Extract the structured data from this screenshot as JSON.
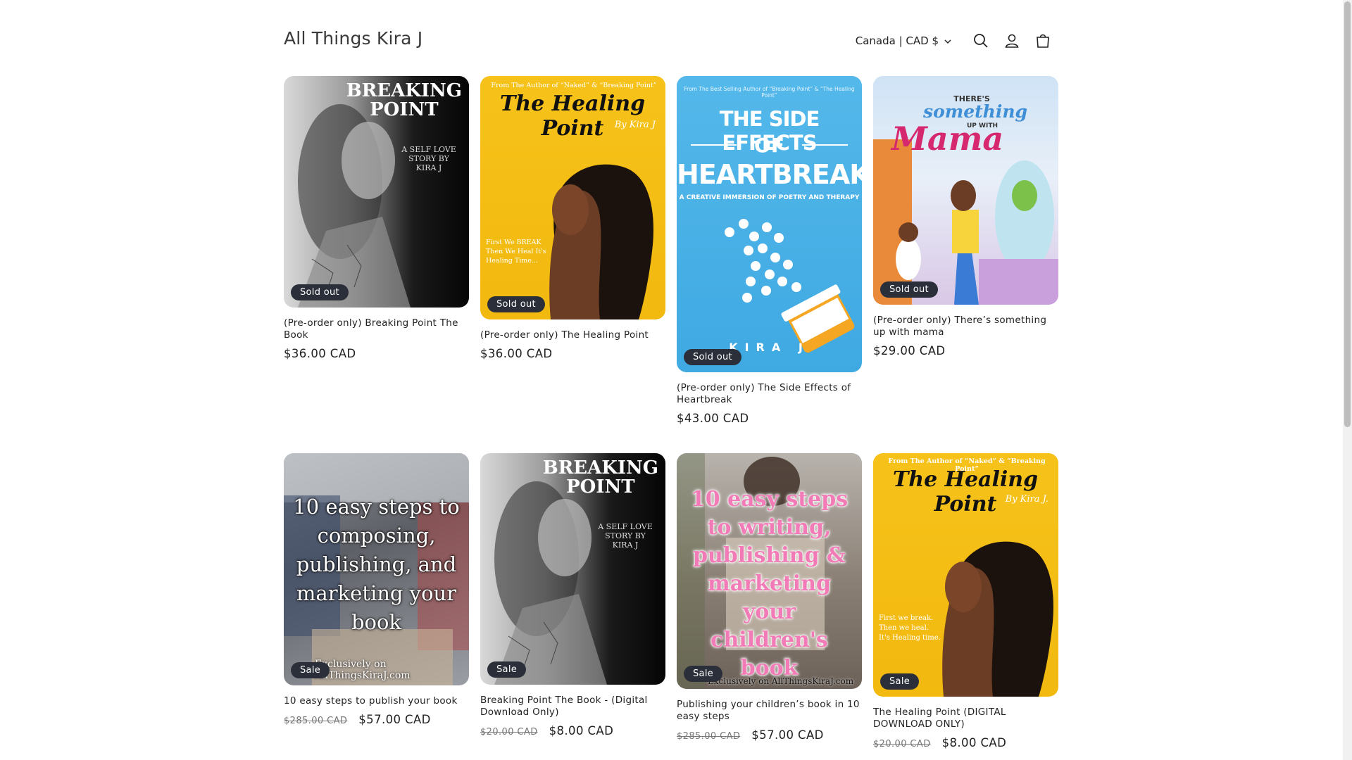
{
  "header": {
    "logo": "All Things Kira J",
    "country_selector": "Canada | CAD $",
    "icons": [
      "search-icon",
      "account-icon",
      "cart-icon"
    ]
  },
  "colors": {
    "badge_bg": "#2b2f3a",
    "text": "#222222",
    "muted": "#777777",
    "yellow_cover": "#f3bc12",
    "blue_cover": "#4ab1e6"
  },
  "products": [
    {
      "title": "(Pre-order only) Breaking Point The Book",
      "price": "$36.00 CAD",
      "badge": "Sold out",
      "cover": {
        "line1": "BREAKING",
        "line2": "POINT",
        "sub": "A SELF LOVE STORY BY KIRA J"
      }
    },
    {
      "title": "(Pre-order only) The Healing Point",
      "price": "$36.00 CAD",
      "badge": "Sold out",
      "cover": {
        "top": "From The Author of “Naked” & “Breaking Point”",
        "title": "The Healing Point",
        "by": "By Kira J",
        "tag": "First We BREAK Then We Heal It's Healing Time..."
      }
    },
    {
      "title": "(Pre-order only) The Side Effects of Heartbreak",
      "price": "$43.00 CAD",
      "badge": "Sold out",
      "cover": {
        "top": "From The Best Selling Author of “Breaking Point” & “The Healing Point”",
        "l1": "THE SIDE EFFECTS",
        "l2": "OF",
        "l3": "HEARTBREAK",
        "sub": "A CREATIVE IMMERSION OF POETRY AND THERAPY",
        "author": "KIRA J"
      }
    },
    {
      "title": "(Pre-order only) There’s something up with mama",
      "price": "$29.00 CAD",
      "badge": "Sold out",
      "cover": {
        "l1": "THERE'S",
        "l2": "something",
        "l3": "UP WITH",
        "l4": "Mama"
      }
    },
    {
      "title": "10 easy steps to publish your book",
      "compare_price": "$285.00 CAD",
      "price": "$57.00 CAD",
      "badge": "Sale",
      "cover": {
        "text": "10 easy steps to composing, publishing, and marketing your book",
        "foot": "Exclusively on AllThingsKiraJ.com"
      }
    },
    {
      "title": "Breaking Point The Book - (Digital Download Only)",
      "compare_price": "$20.00 CAD",
      "price": "$8.00 CAD",
      "badge": "Sale",
      "cover": {
        "line1": "BREAKING",
        "line2": "POINT",
        "sub": "A SELF LOVE STORY BY KIRA J"
      }
    },
    {
      "title": "Publishing your children’s book in 10 easy steps",
      "compare_price": "$285.00 CAD",
      "price": "$57.00 CAD",
      "badge": "Sale",
      "cover": {
        "text": "10 easy steps to writing, publishing & marketing your children's book",
        "foot": "Exclusively on AllThingsKiraJ.com"
      }
    },
    {
      "title": "The Healing Point (DIGITAL DOWNLOAD ONLY)",
      "compare_price": "$20.00 CAD",
      "price": "$8.00 CAD",
      "badge": "Sale",
      "cover": {
        "top": "From The Author of “Naked” & “Breaking Point”",
        "title": "The Healing Point",
        "by": "By Kira J.",
        "tag": "First we break. Then we heal. It's Healing time."
      }
    }
  ]
}
